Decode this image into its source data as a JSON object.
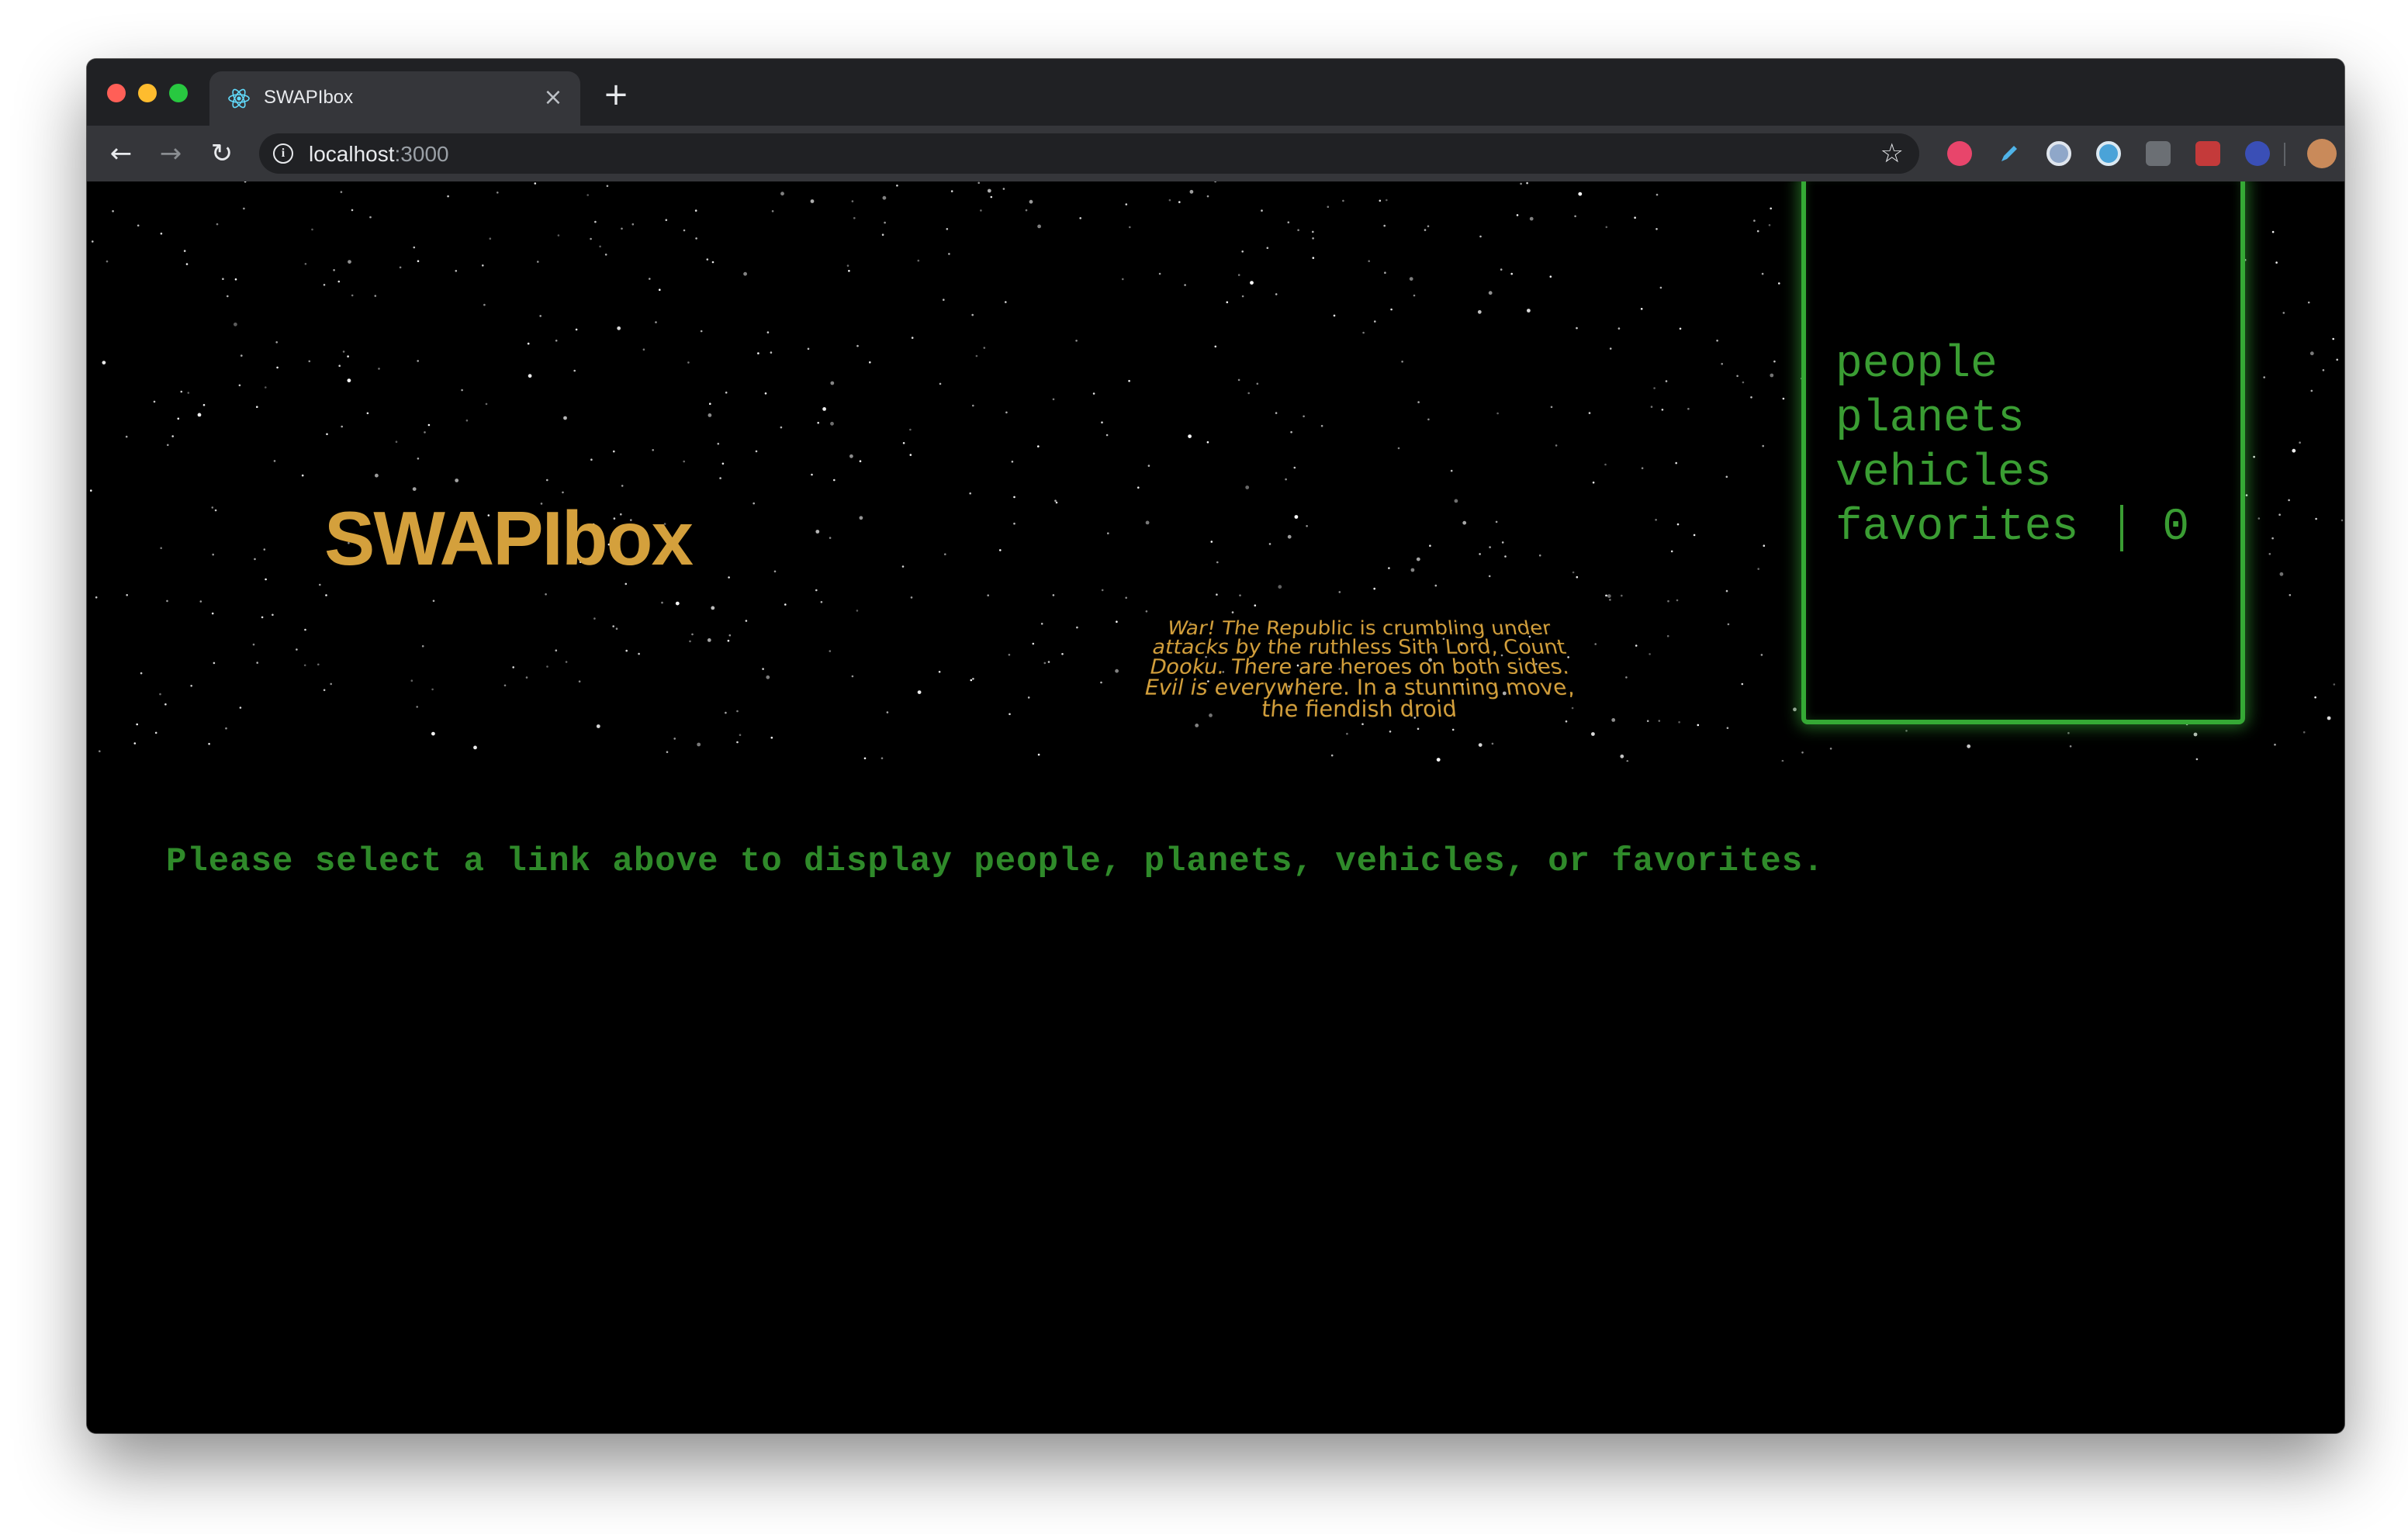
{
  "browser": {
    "tab_title": "SWAPIbox",
    "tab_close": "×",
    "new_tab": "+",
    "url_host": "localhost",
    "url_port": ":3000",
    "back": "←",
    "forward": "→",
    "reload": "↻",
    "star": "☆",
    "menu": "⋮",
    "extension_icons": [
      "translate-extension-icon",
      "pencil-extension-icon",
      "circle-extension-icon",
      "chromecast-extension-icon",
      "bulb-extension-icon",
      "red-puzzle-extension-icon",
      "globe-extension-icon",
      "profile-avatar-icon"
    ]
  },
  "app": {
    "title": "SWAPIbox",
    "crawl_text": "War! The Republic is crumbling under attacks by the ruthless Sith Lord, Count Dooku. There are heroes on both sides. Evil is everywhere. In a stunning move, the fiendish droid",
    "nav": {
      "people": "people",
      "planets": "planets",
      "vehicles": "vehicles",
      "favorites": "favorites",
      "favorites_count": "0"
    },
    "message": "Please select a link above to display people, planets, vehicles, or favorites."
  },
  "colors": {
    "title_gold": "#d4a03c",
    "nav_green": "#3a9d33",
    "border_green": "#35a935",
    "message_green": "#2f8a2a"
  }
}
